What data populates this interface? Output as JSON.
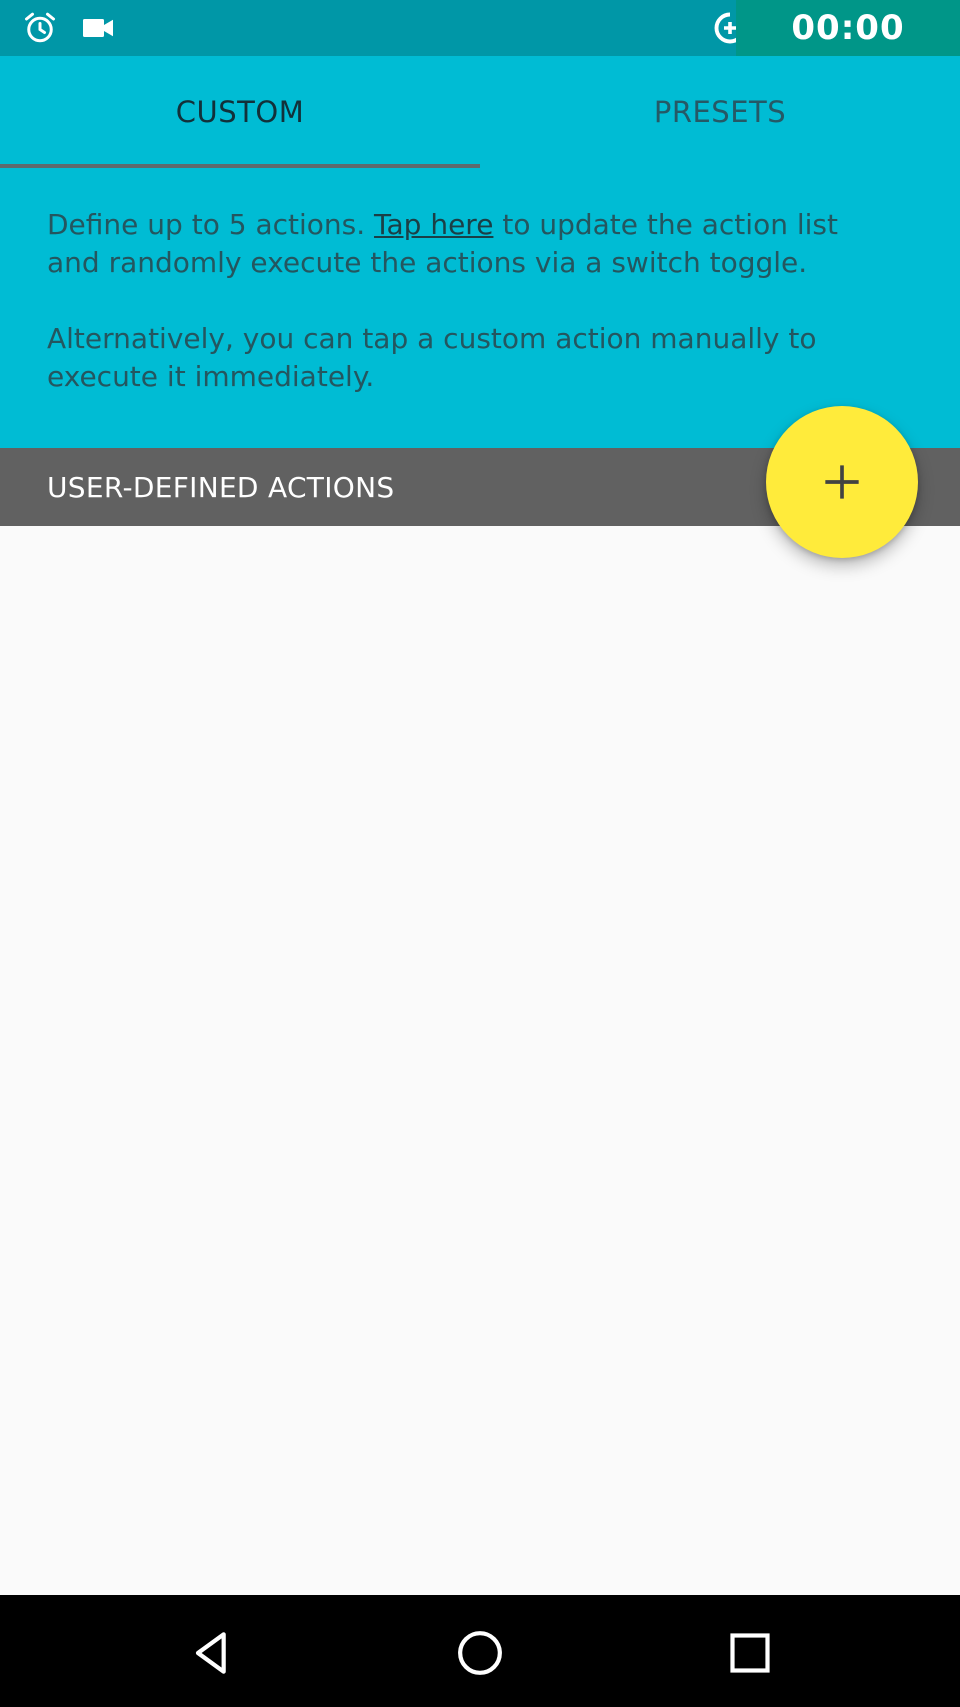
{
  "status_bar": {
    "time": "00:00",
    "icons": [
      "alarm-icon",
      "videocam-icon",
      "data-saver-icon"
    ],
    "background": "#0097A7"
  },
  "tabs": [
    {
      "label": "CUSTOM",
      "selected": true
    },
    {
      "label": "PRESETS",
      "selected": false
    }
  ],
  "description": {
    "p1_before_link": "Define up to 5 actions. ",
    "link_text": "Tap here",
    "p1_after_link": " to update the action list and randomly execute the actions via a switch toggle.",
    "p2": "Alternatively, you can tap a custom action manually to execute it immediately."
  },
  "section_header": {
    "title": "USER-DEFINED ACTIONS"
  },
  "fab": {
    "icon": "plus-icon",
    "color": "#FFEB3B"
  },
  "nav_bar": {
    "buttons": [
      "back-icon",
      "home-icon",
      "recents-icon"
    ]
  },
  "colors": {
    "primary": "#00BCD4",
    "primary_dark": "#0097A7",
    "section_header": "#616161",
    "accent": "#FFEB3B"
  }
}
